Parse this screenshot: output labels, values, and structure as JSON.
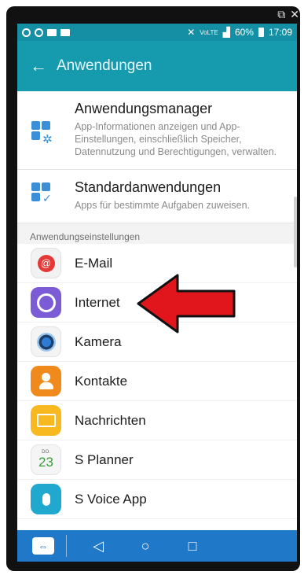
{
  "window": {
    "corner_icons": [
      "expand-icon",
      "close-icon"
    ]
  },
  "status_bar": {
    "left_icons": [
      "whatsapp-icon",
      "instagram-icon",
      "image-icon",
      "folder-icon"
    ],
    "right_icons": [
      "mute-icon",
      "volte-icon",
      "signal-icon"
    ],
    "battery": "60%",
    "time": "17:09"
  },
  "app_bar": {
    "back_icon": "back-arrow-icon",
    "title": "Anwendungen"
  },
  "top_items": [
    {
      "icon": "app-grid-gear-icon",
      "title": "Anwendungsmanager",
      "description": "App-Informationen anzeigen und App-Einstellungen, einschließlich Speicher, Datennutzung und Berechtigungen, verwalten."
    },
    {
      "icon": "app-grid-check-icon",
      "title": "Standardanwendungen",
      "description": "Apps für bestimmte Aufgaben zuweisen."
    }
  ],
  "section_header": "Anwendungseinstellungen",
  "app_list": [
    {
      "icon": "email-icon",
      "label": "E-Mail"
    },
    {
      "icon": "internet-icon",
      "label": "Internet"
    },
    {
      "icon": "camera-icon",
      "label": "Kamera"
    },
    {
      "icon": "contacts-icon",
      "label": "Kontakte"
    },
    {
      "icon": "messages-icon",
      "label": "Nachrichten"
    },
    {
      "icon": "planner-icon",
      "label": "S Planner",
      "calendar_day": "DO.",
      "calendar_date": "23"
    },
    {
      "icon": "voice-icon",
      "label": "S Voice App"
    }
  ],
  "annotation": {
    "type": "red-arrow",
    "points_to": "E-Mail",
    "color": "#e0161c"
  },
  "nav_bar": {
    "icons": [
      "teamviewer-icon",
      "back-icon",
      "home-icon",
      "recents-icon"
    ],
    "color": "#1f78c8"
  },
  "colors": {
    "status_bar": "#158fa4",
    "app_bar": "#169aae",
    "accent_icon": "#3a8fd6"
  }
}
